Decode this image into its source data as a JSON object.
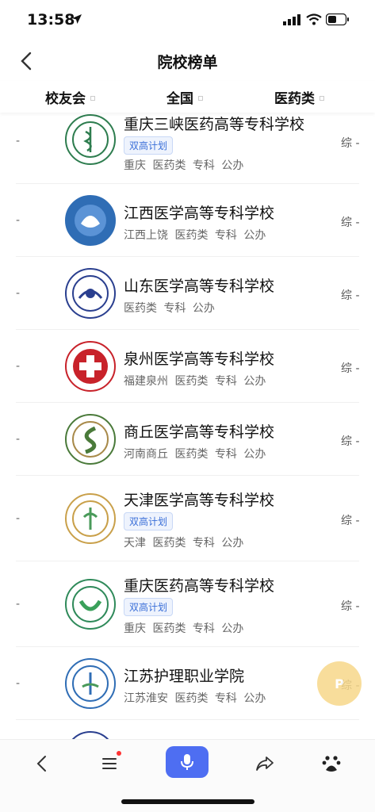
{
  "status": {
    "time": "13:58"
  },
  "nav": {
    "title": "院校榜单"
  },
  "filters": [
    {
      "label": "校友会"
    },
    {
      "label": "全国"
    },
    {
      "label": "医药类"
    }
  ],
  "items": [
    {
      "name": "重庆三峡医药高等专科学校",
      "tag": "双高计划",
      "meta": "重庆 医药类 专科 公办",
      "dash": "-",
      "rank": "综 -",
      "color": "#2e7d4f"
    },
    {
      "name": "江西医学高等专科学校",
      "tag": "",
      "meta": "江西上饶 医药类 专科 公办",
      "dash": "-",
      "rank": "综 -",
      "color": "#2f6db5"
    },
    {
      "name": "山东医学高等专科学校",
      "tag": "",
      "meta": "医药类 专科 公办",
      "dash": "-",
      "rank": "综 -",
      "color": "#2a3f8f"
    },
    {
      "name": "泉州医学高等专科学校",
      "tag": "",
      "meta": "福建泉州 医药类 专科 公办",
      "dash": "-",
      "rank": "综 -",
      "color": "#c8222a"
    },
    {
      "name": "商丘医学高等专科学校",
      "tag": "",
      "meta": "河南商丘 医药类 专科 公办",
      "dash": "-",
      "rank": "综 -",
      "color": "#4a7a3a"
    },
    {
      "name": "天津医学高等专科学校",
      "tag": "双高计划",
      "meta": "天津 医药类 专科 公办",
      "dash": "-",
      "rank": "综 -",
      "color": "#c9a04a"
    },
    {
      "name": "重庆医药高等专科学校",
      "tag": "双高计划",
      "meta": "重庆 医药类 专科 公办",
      "dash": "-",
      "rank": "综 -",
      "color": "#2f8a5a"
    },
    {
      "name": "江苏护理职业学院",
      "tag": "",
      "meta": "江苏淮安 医药类 专科 公办",
      "dash": "-",
      "rank": "综 -",
      "color": "#2f6db5"
    }
  ],
  "float_badge": "P",
  "icons": {
    "back": "chevron-left-icon",
    "menu": "menu-icon",
    "mic": "microphone-icon",
    "share": "share-icon",
    "baidu": "baidu-paw-icon"
  }
}
